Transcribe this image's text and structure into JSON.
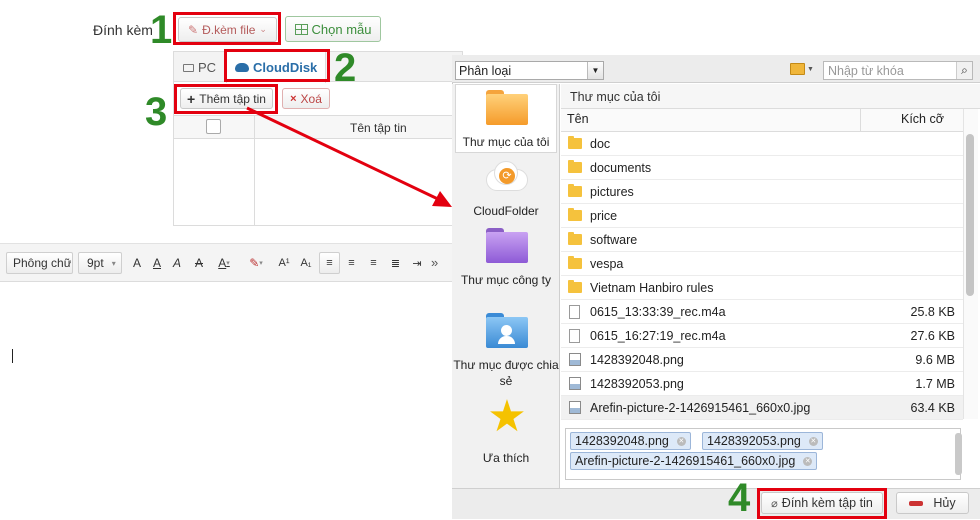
{
  "attach": {
    "label": "Đính kèm",
    "attach_file_btn": "Đ.kèm file",
    "choose_template_btn": "Chọn mẫu"
  },
  "tabs": {
    "pc": "PC",
    "clouddisk": "CloudDisk"
  },
  "file_actions": {
    "add_file": "Thêm tập tin",
    "delete": "Xoá"
  },
  "table": {
    "col_filename": "Tên tập tin"
  },
  "steps": {
    "s1": "1",
    "s2": "2",
    "s3": "3",
    "s4": "4"
  },
  "editor": {
    "font": "Phông chữ",
    "size": "9pt",
    "more": "»"
  },
  "dialog": {
    "category": "Phân loại",
    "search_placeholder": "Nhập từ khóa",
    "breadcrumb": "Thư mục của tôi",
    "col_name": "Tên",
    "col_size": "Kích cỡ",
    "left_items": [
      {
        "label": "Thư mục của tôi"
      },
      {
        "label": "CloudFolder"
      },
      {
        "label": "Thư mục công ty"
      },
      {
        "label": "Thư mục được chia sẻ"
      },
      {
        "label": "Ưa thích"
      }
    ],
    "files": [
      {
        "name": "doc",
        "size": "",
        "kind": "folder"
      },
      {
        "name": "documents",
        "size": "",
        "kind": "folder"
      },
      {
        "name": "pictures",
        "size": "",
        "kind": "folder"
      },
      {
        "name": "price",
        "size": "",
        "kind": "folder"
      },
      {
        "name": "software",
        "size": "",
        "kind": "folder"
      },
      {
        "name": "vespa",
        "size": "",
        "kind": "folder"
      },
      {
        "name": "Vietnam Hanbiro rules",
        "size": "",
        "kind": "folder"
      },
      {
        "name": "0615_13:33:39_rec.m4a",
        "size": "25.8 KB",
        "kind": "doc"
      },
      {
        "name": "0615_16:27:19_rec.m4a",
        "size": "27.6 KB",
        "kind": "doc"
      },
      {
        "name": "1428392048.png",
        "size": "9.6 MB",
        "kind": "img"
      },
      {
        "name": "1428392053.png",
        "size": "1.7 MB",
        "kind": "img"
      },
      {
        "name": "Arefin-picture-2-1426915461_660x0.jpg",
        "size": "63.4 KB",
        "kind": "img"
      }
    ],
    "selected": [
      {
        "name": "1428392048.png"
      },
      {
        "name": "1428392053.png"
      },
      {
        "name": "Arefin-picture-2-1426915461_660x0.jpg"
      }
    ],
    "attach_btn": "Đính kèm tập tin",
    "cancel_btn": "Hủy"
  }
}
